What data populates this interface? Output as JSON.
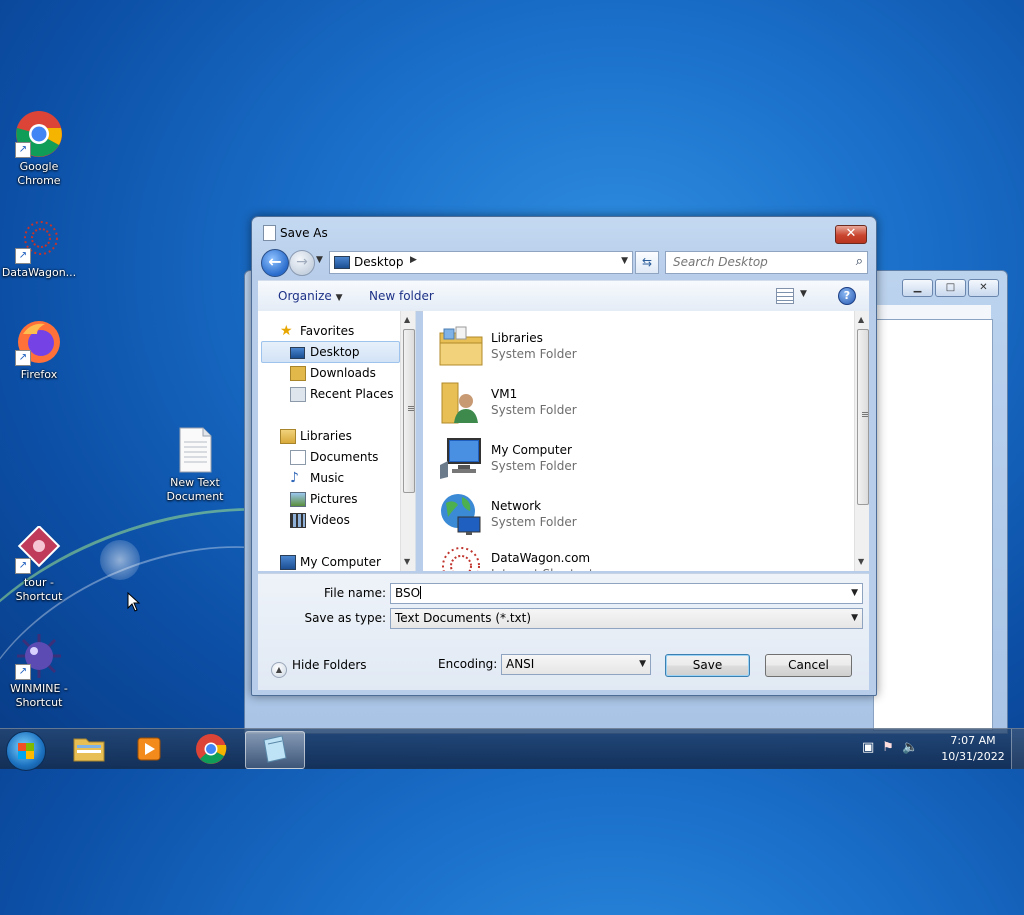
{
  "desktop": {
    "icons": [
      {
        "label": "Google Chrome",
        "icon": "chrome-icon"
      },
      {
        "label": "DataWagon...",
        "icon": "datawagon-icon"
      },
      {
        "label": "Firefox",
        "icon": "firefox-icon"
      },
      {
        "label": "New Text Document",
        "icon": "text-document-icon"
      },
      {
        "label": "tour - Shortcut",
        "icon": "tour-icon"
      },
      {
        "label": "WINMINE - Shortcut",
        "icon": "winmine-icon"
      }
    ]
  },
  "dialog": {
    "title": "Save As",
    "close_label": "✕",
    "address": {
      "location": "Desktop"
    },
    "search": {
      "placeholder": "Search Desktop"
    },
    "toolbar": {
      "organize": "Organize",
      "new_folder": "New folder",
      "help": "?"
    },
    "nav": {
      "favorites": "Favorites",
      "desktop": "Desktop",
      "downloads": "Downloads",
      "recent_places": "Recent Places",
      "libraries": "Libraries",
      "documents": "Documents",
      "music": "Music",
      "pictures": "Pictures",
      "videos": "Videos",
      "my_computer": "My Computer"
    },
    "files": [
      {
        "name": "Libraries",
        "type": "System Folder"
      },
      {
        "name": "VM1",
        "type": "System Folder"
      },
      {
        "name": "My Computer",
        "type": "System Folder"
      },
      {
        "name": "Network",
        "type": "System Folder"
      },
      {
        "name": "DataWagon.com",
        "type": "Internet Shortcut"
      }
    ],
    "file_name_label": "File name:",
    "file_name_value": "BSO",
    "save_type_label": "Save as type:",
    "save_type_value": "Text Documents (*.txt)",
    "hide_folders": "Hide Folders",
    "encoding_label": "Encoding:",
    "encoding_value": "ANSI",
    "save_button": "Save",
    "cancel_button": "Cancel"
  },
  "taskbar": {
    "time": "7:07 AM",
    "date": "10/31/2022"
  },
  "colors": {
    "accent": "#1a6fc9",
    "close_red": "#c9452f"
  }
}
